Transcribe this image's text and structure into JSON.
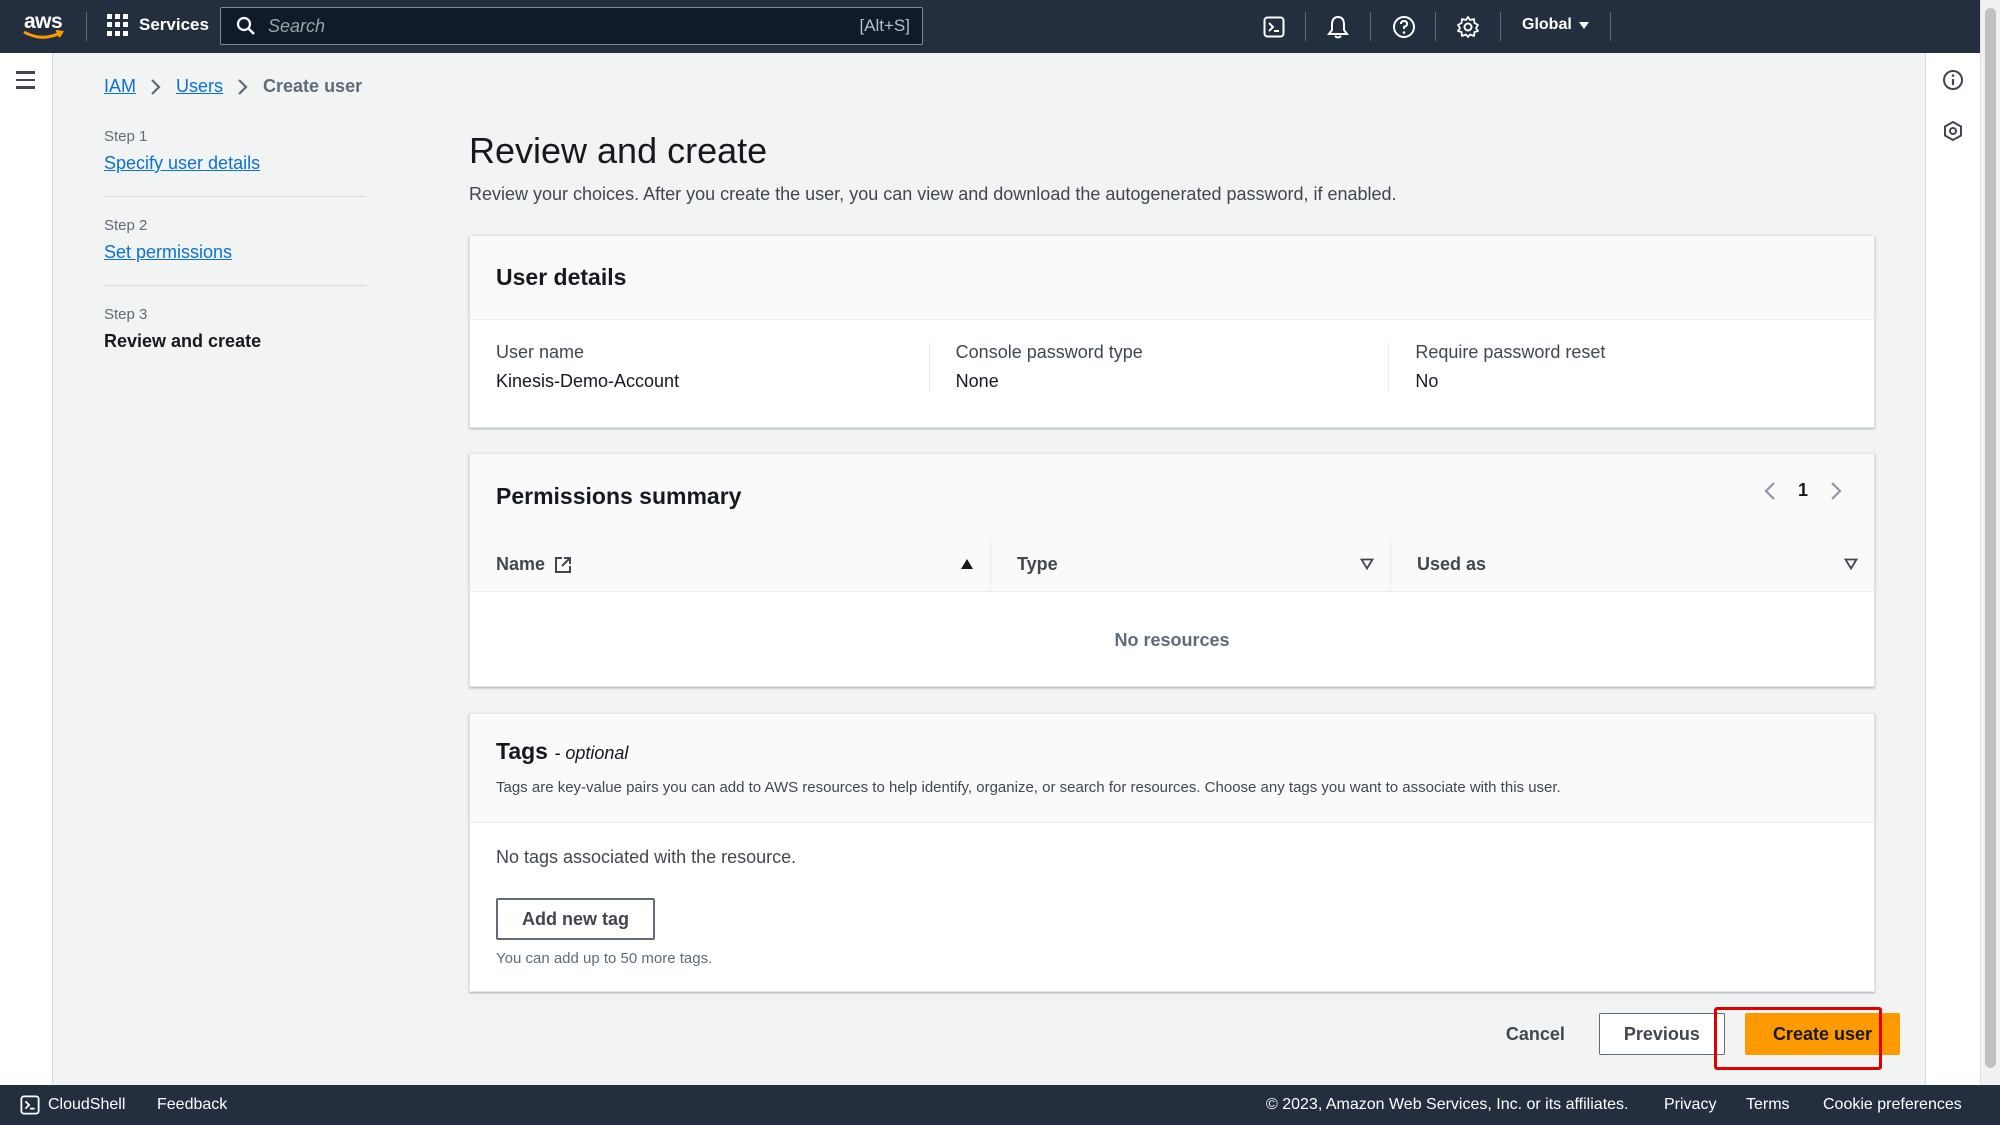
{
  "topnav": {
    "logo_text": "aws",
    "services_label": "Services",
    "search_placeholder": "Search",
    "search_shortcut": "[Alt+S]",
    "region_label": "Global"
  },
  "breadcrumb": {
    "items": [
      "IAM",
      "Users"
    ],
    "current": "Create user"
  },
  "steps": [
    {
      "num": "Step 1",
      "label": "Specify user details"
    },
    {
      "num": "Step 2",
      "label": "Set permissions"
    },
    {
      "num": "Step 3",
      "label": "Review and create"
    }
  ],
  "page": {
    "title": "Review and create",
    "description": "Review your choices. After you create the user, you can view and download the autogenerated password, if enabled."
  },
  "user_details": {
    "title": "User details",
    "fields": [
      {
        "label": "User name",
        "value": "Kinesis-Demo-Account"
      },
      {
        "label": "Console password type",
        "value": "None"
      },
      {
        "label": "Require password reset",
        "value": "No"
      }
    ]
  },
  "permissions": {
    "title": "Permissions summary",
    "page_number": "1",
    "columns": [
      "Name",
      "Type",
      "Used as"
    ],
    "empty_text": "No resources"
  },
  "tags": {
    "title": "Tags",
    "optional": "- optional",
    "description": "Tags are key-value pairs you can add to AWS resources to help identify, organize, or search for resources. Choose any tags you want to associate with this user.",
    "none_text": "No tags associated with the resource.",
    "add_button": "Add new tag",
    "limit_text": "You can add up to 50 more tags."
  },
  "actions": {
    "cancel": "Cancel",
    "previous": "Previous",
    "create": "Create user"
  },
  "footer": {
    "cloudshell": "CloudShell",
    "feedback": "Feedback",
    "copyright": "© 2023, Amazon Web Services, Inc. or its affiliates.",
    "privacy": "Privacy",
    "terms": "Terms",
    "cookie": "Cookie preferences"
  },
  "colors": {
    "nav_bg": "#232f3e",
    "link": "#0972d3",
    "primary": "#ff9900",
    "highlight": "#e00000"
  },
  "icons": [
    "grid-icon",
    "search-icon",
    "cloudshell-icon",
    "bell-icon",
    "help-icon",
    "gear-icon",
    "caret-down-icon",
    "menu-icon",
    "info-icon",
    "settings-hex-icon",
    "external-link-icon",
    "chevron-left-icon",
    "chevron-right-icon",
    "sort-asc-icon",
    "sort-desc-icon"
  ]
}
